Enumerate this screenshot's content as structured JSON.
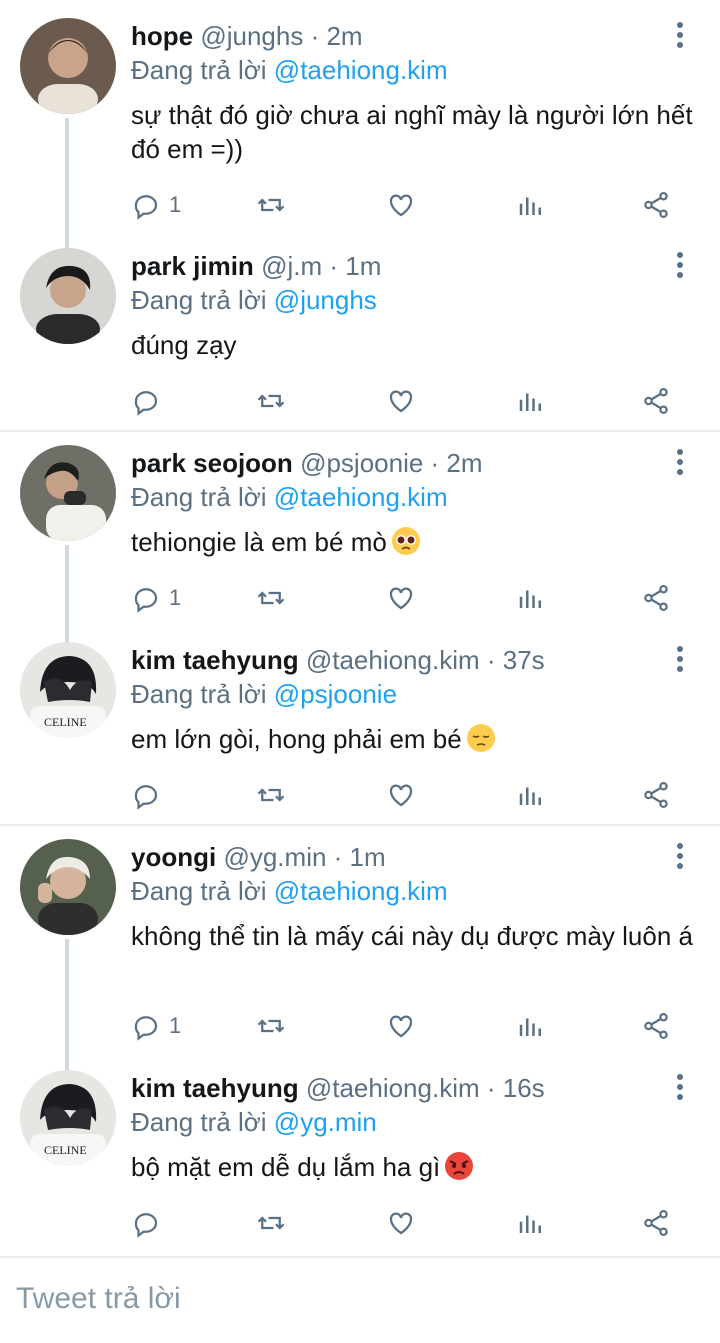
{
  "tweets": [
    {
      "name": "hope",
      "handle": "@junghs",
      "time": "2m",
      "reply_prefix": "Đang trả lời",
      "reply_to": "@taehiong.kim",
      "text": "sự thật đó giờ chưa ai nghĩ mày là người lớn hết đó em =))",
      "emoji": "",
      "reply_count": "1",
      "avatar_color": "#6b5a4e"
    },
    {
      "name": "park jimin",
      "handle": "@j.m",
      "time": "1m",
      "reply_prefix": "Đang trả lời",
      "reply_to": "@junghs",
      "text": "đúng zạy",
      "emoji": "",
      "reply_count": "",
      "avatar_color": "#3a3a3a"
    },
    {
      "name": "park seojoon",
      "handle": "@psjoonie",
      "time": "2m",
      "reply_prefix": "Đang trả lời",
      "reply_to": "@taehiong.kim",
      "text": "tehiongie là em bé mò",
      "emoji": "pleading-face-emoji",
      "reply_count": "1",
      "avatar_color": "#8a8a82"
    },
    {
      "name": "kim taehyung",
      "handle": "@taehiong.kim",
      "time": "37s",
      "reply_prefix": "Đang trả lời",
      "reply_to": "@psjoonie",
      "text": "em lớn gòi, hong phải em bé",
      "emoji": "pensive-face-emoji",
      "reply_count": "",
      "avatar_color": "#2b2b30"
    },
    {
      "name": "yoongi",
      "handle": "@yg.min",
      "time": "1m",
      "reply_prefix": "Đang trả lời",
      "reply_to": "@taehiong.kim",
      "text": "không thể tin là mấy cái này dụ được mày luôn á",
      "emoji": "",
      "reply_count": "1",
      "avatar_color": "#55604e"
    },
    {
      "name": "kim taehyung",
      "handle": "@taehiong.kim",
      "time": "16s",
      "reply_prefix": "Đang trả lời",
      "reply_to": "@yg.min",
      "text": "bộ mặt em dễ dụ lắm ha gì",
      "emoji": "angry-face-emoji",
      "reply_count": "",
      "avatar_color": "#2b2b30"
    }
  ],
  "separator": " · ",
  "composer": {
    "placeholder": "Tweet trả lời"
  },
  "colors": {
    "accent": "#1da1f2",
    "muted": "#5b7083",
    "divider": "#e6ecf0"
  }
}
